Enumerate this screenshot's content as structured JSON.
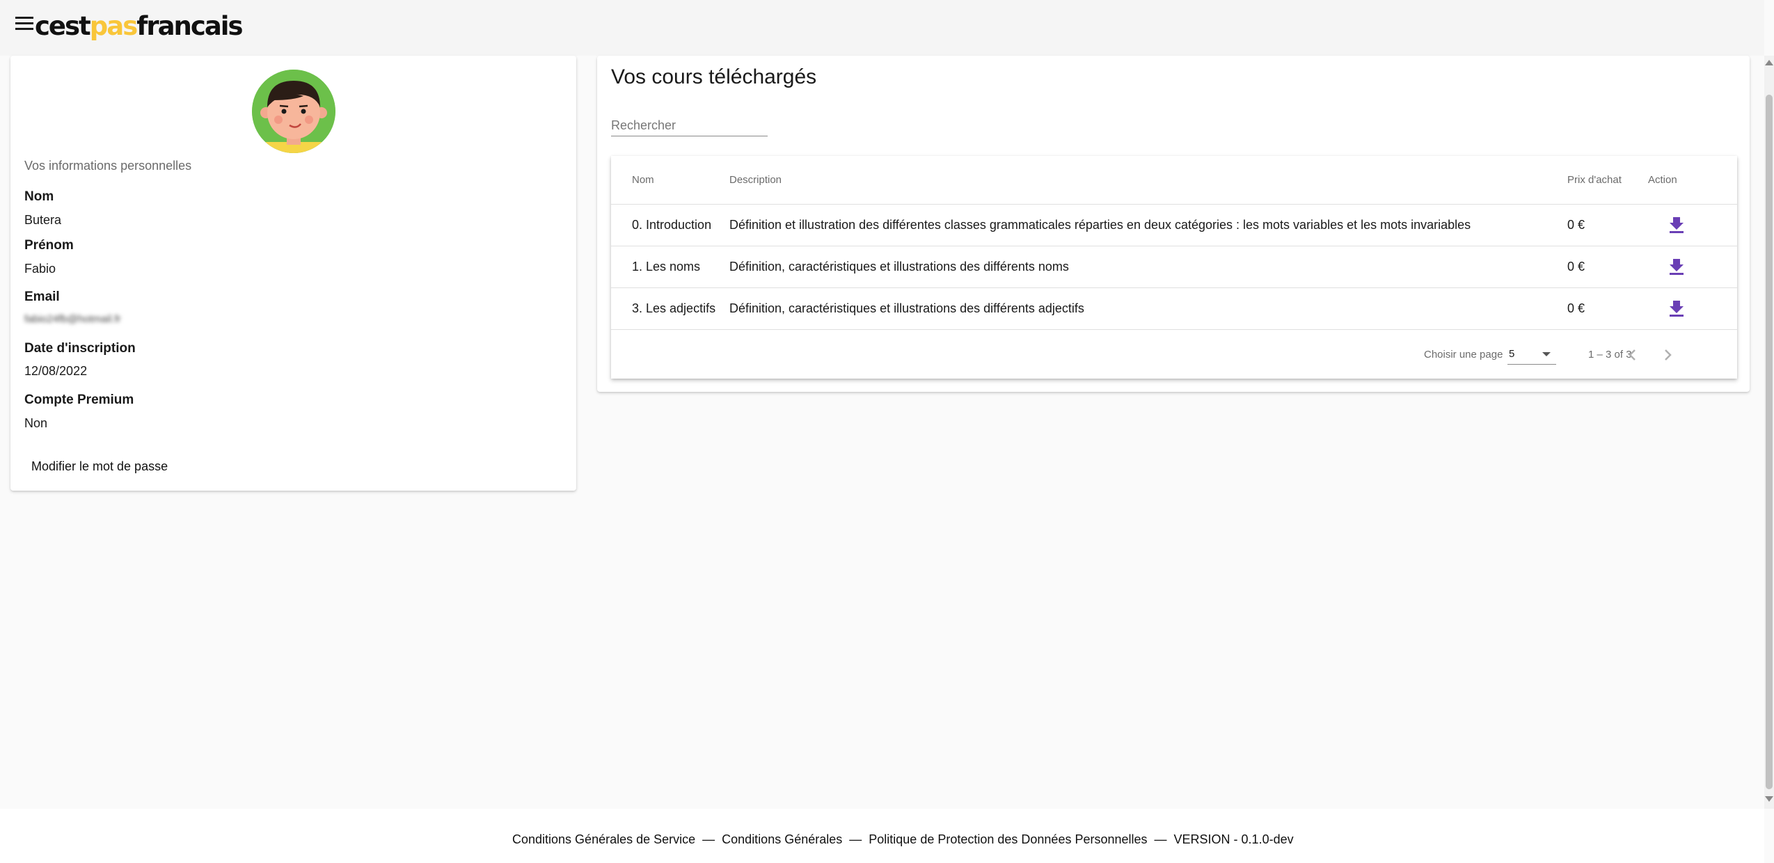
{
  "header": {
    "logo_part1": "cest",
    "logo_part2": "pas",
    "logo_part3": "francais",
    "menu_icon": "menu-icon"
  },
  "profile": {
    "section_label": "Vos informations personnelles",
    "fields": [
      {
        "label": "Nom",
        "value": "Butera"
      },
      {
        "label": "Prénom",
        "value": "Fabio"
      },
      {
        "label": "Email",
        "value": "fabio24fb@hotmail.fr"
      },
      {
        "label": "Date d'inscription",
        "value": "12/08/2022"
      },
      {
        "label": "Compte Premium",
        "value": "Non"
      }
    ],
    "change_password_label": "Modifier le mot de passe",
    "avatar_icon": "boy-avatar-icon"
  },
  "courses": {
    "title": "Vos cours téléchargés",
    "search_placeholder": "Rechercher",
    "columns": [
      "Nom",
      "Description",
      "Prix d'achat",
      "Action"
    ],
    "rows": [
      {
        "name": "0. Introduction",
        "description": "Définition et illustration des différentes classes grammaticales réparties en deux catégories : les mots variables et les mots invariables",
        "price": "0 €",
        "action_icon": "download-icon"
      },
      {
        "name": "1. Les noms",
        "description": "Définition, caractéristiques et illustrations des différents noms",
        "price": "0 €",
        "action_icon": "download-icon"
      },
      {
        "name": "3. Les adjectifs",
        "description": "Définition, caractéristiques et illustrations des différents adjectifs",
        "price": "0 €",
        "action_icon": "download-icon"
      }
    ],
    "paginator": {
      "page_size_label": "Choisir une page",
      "page_size": "5",
      "range": "1 – 3 of 3"
    }
  },
  "footer": {
    "links": [
      "Conditions Générales de Service",
      "Conditions Générales",
      "Politique de Protection des Données Personnelles",
      "VERSION - 0.1.0-dev"
    ],
    "separator": "—"
  },
  "colors": {
    "accent": "#6a3fb5",
    "logo_yellow": "#f9c63a",
    "avatar_bg": "#6cc04a"
  }
}
